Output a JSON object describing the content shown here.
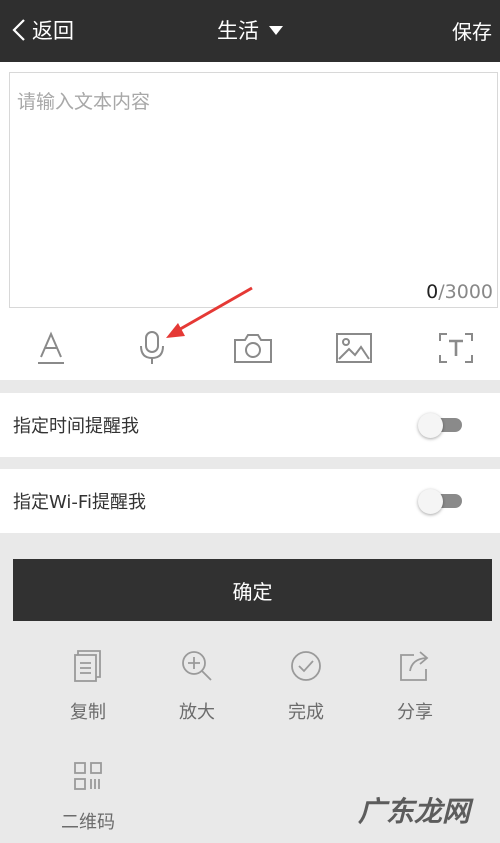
{
  "header": {
    "back_label": "返回",
    "title": "生活",
    "save_label": "保存"
  },
  "editor": {
    "placeholder": "请输入文本内容",
    "count_current": "0",
    "count_max": "/3000"
  },
  "toolbar": {
    "icons": [
      "text-format-icon",
      "microphone-icon",
      "camera-icon",
      "image-icon",
      "text-recognition-icon"
    ]
  },
  "reminders": {
    "time_label": "指定时间提醒我",
    "wifi_label": "指定Wi-Fi提醒我"
  },
  "confirm_label": "确定",
  "actions": [
    {
      "label": "复制",
      "icon": "copy-icon"
    },
    {
      "label": "放大",
      "icon": "zoom-in-icon"
    },
    {
      "label": "完成",
      "icon": "check-circle-icon"
    },
    {
      "label": "分享",
      "icon": "share-icon"
    },
    {
      "label": "二维码",
      "icon": "qr-code-icon"
    }
  ],
  "watermark": "广东龙网",
  "colors": {
    "header_bg": "#2f2f2f",
    "confirm_bg": "#313131",
    "arrow": "#e53935"
  }
}
